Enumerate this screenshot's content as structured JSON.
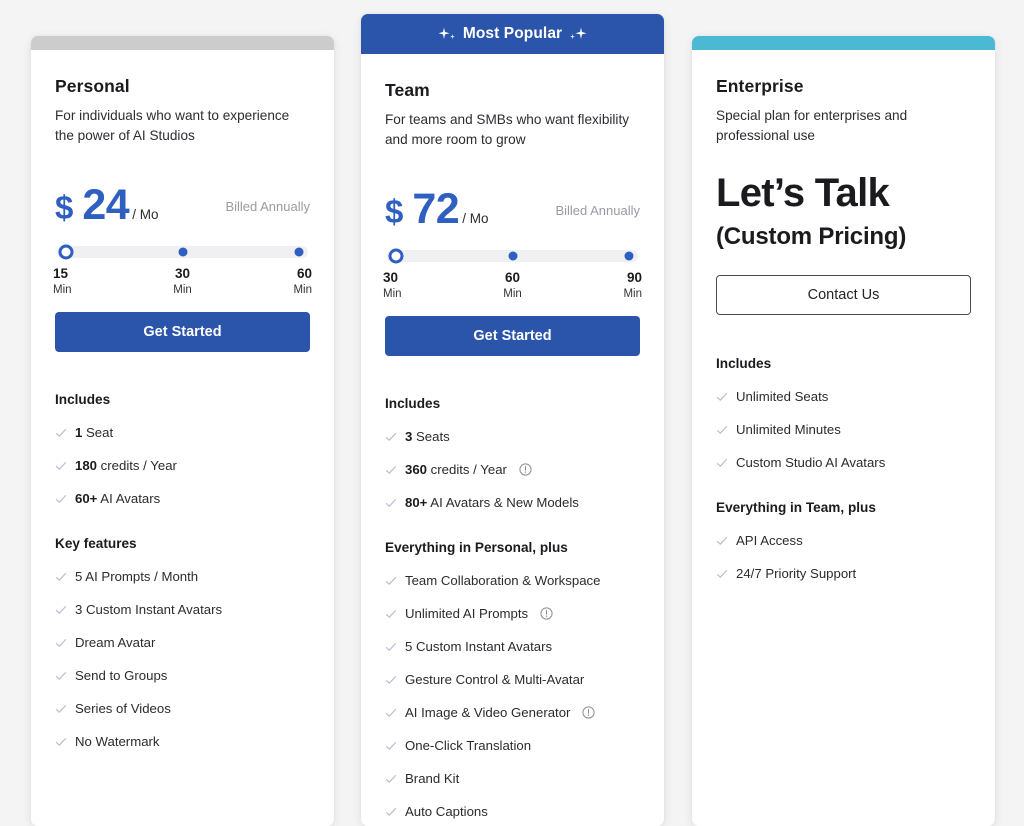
{
  "theme": {
    "page_background": "#f4f4f4",
    "brand_blue": "#2b55ab",
    "price_blue": "#2f5fc0",
    "accent_gray": "#cccccc",
    "accent_teal": "#4cb9d4",
    "check_color": "#b9bcd4",
    "muted_text": "#9a9aa4"
  },
  "plans": [
    {
      "id": "personal",
      "accent": "gray",
      "badge": null,
      "name": "Personal",
      "description": "For individuals who want to experience the power of AI Studios",
      "price": {
        "currency": "$",
        "amount": "24",
        "period": "/ Mo",
        "billing_note": "Billed Annually"
      },
      "slider": {
        "selected_index": 0,
        "stops": [
          {
            "value": "15",
            "unit": "Min"
          },
          {
            "value": "30",
            "unit": "Min"
          },
          {
            "value": "60",
            "unit": "Min"
          }
        ]
      },
      "cta": {
        "label": "Get Started",
        "style": "primary"
      },
      "sections": [
        {
          "heading": "Includes",
          "items": [
            {
              "strong": "1",
              "text": " Seat",
              "info": false
            },
            {
              "strong": "180",
              "text": " credits / Year",
              "info": false
            },
            {
              "strong": "60+",
              "text": " AI Avatars",
              "info": false
            }
          ]
        },
        {
          "heading": "Key features",
          "items": [
            {
              "strong": "",
              "text": "5 AI Prompts / Month",
              "info": false
            },
            {
              "strong": "",
              "text": "3 Custom Instant Avatars",
              "info": false
            },
            {
              "strong": "",
              "text": "Dream Avatar",
              "info": false
            },
            {
              "strong": "",
              "text": "Send to Groups",
              "info": false
            },
            {
              "strong": "",
              "text": "Series of Videos",
              "info": false
            },
            {
              "strong": "",
              "text": "No Watermark",
              "info": false
            }
          ]
        }
      ]
    },
    {
      "id": "team",
      "accent": "banner",
      "badge": "Most Popular",
      "name": "Team",
      "description": "For teams and SMBs who want flexibility and more room to grow",
      "price": {
        "currency": "$",
        "amount": "72",
        "period": "/ Mo",
        "billing_note": "Billed Annually"
      },
      "slider": {
        "selected_index": 0,
        "stops": [
          {
            "value": "30",
            "unit": "Min"
          },
          {
            "value": "60",
            "unit": "Min"
          },
          {
            "value": "90",
            "unit": "Min"
          }
        ]
      },
      "cta": {
        "label": "Get Started",
        "style": "primary"
      },
      "sections": [
        {
          "heading": "Includes",
          "items": [
            {
              "strong": "3",
              "text": " Seats",
              "info": false
            },
            {
              "strong": "360",
              "text": " credits / Year",
              "info": true
            },
            {
              "strong": "80+",
              "text": " AI Avatars & New Models",
              "info": false
            }
          ]
        },
        {
          "heading": "Everything in Personal, plus",
          "items": [
            {
              "strong": "",
              "text": "Team Collaboration & Workspace",
              "info": false
            },
            {
              "strong": "",
              "text": "Unlimited AI Prompts",
              "info": true
            },
            {
              "strong": "",
              "text": "5 Custom Instant Avatars",
              "info": false
            },
            {
              "strong": "",
              "text": "Gesture Control & Multi-Avatar",
              "info": false
            },
            {
              "strong": "",
              "text": "AI Image & Video Generator",
              "info": true
            },
            {
              "strong": "",
              "text": "One-Click Translation",
              "info": false
            },
            {
              "strong": "",
              "text": "Brand Kit",
              "info": false
            },
            {
              "strong": "",
              "text": "Auto Captions",
              "info": false
            }
          ]
        }
      ]
    },
    {
      "id": "enterprise",
      "accent": "teal",
      "badge": null,
      "name": "Enterprise",
      "description": "Special plan for enterprises and professional use",
      "headline": "Let’s Talk",
      "subheadline": "(Custom Pricing)",
      "cta": {
        "label": "Contact Us",
        "style": "outline"
      },
      "sections": [
        {
          "heading": "Includes",
          "items": [
            {
              "strong": "",
              "text": "Unlimited Seats",
              "info": false
            },
            {
              "strong": "",
              "text": "Unlimited Minutes",
              "info": false
            },
            {
              "strong": "",
              "text": "Custom Studio AI Avatars",
              "info": false
            }
          ]
        },
        {
          "heading": "Everything in Team, plus",
          "items": [
            {
              "strong": "",
              "text": "API Access",
              "info": false
            },
            {
              "strong": "",
              "text": "24/7 Priority Support",
              "info": false
            }
          ]
        }
      ]
    }
  ]
}
